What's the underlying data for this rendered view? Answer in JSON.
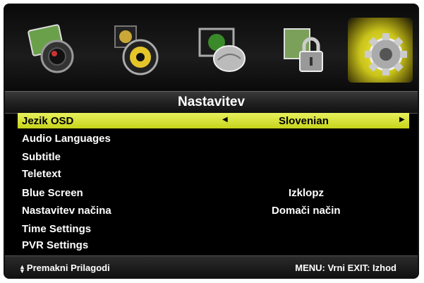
{
  "menu": {
    "title": "Nastavitev",
    "categories": [
      {
        "name": "picture-icon"
      },
      {
        "name": "sound-icon"
      },
      {
        "name": "channel-icon"
      },
      {
        "name": "lock-icon"
      },
      {
        "name": "setup-gear-icon",
        "active": true
      }
    ],
    "items": [
      {
        "label": "Jezik OSD",
        "value": "Slovenian",
        "selected": true
      },
      {
        "label": "Audio Languages",
        "value": ""
      },
      {
        "label": "Subtitle",
        "value": ""
      },
      {
        "label": "Teletext",
        "value": ""
      },
      {
        "label": "Blue Screen",
        "value": "Izklopz"
      },
      {
        "label": "Nastavitev načina",
        "value": "Domači način"
      },
      {
        "label": "Time Settings",
        "value": ""
      },
      {
        "label": "PVR Settings",
        "value": ""
      }
    ]
  },
  "footer": {
    "left": "Premakni Prilagodi",
    "right": "MENU: Vrni EXIT: Izhod"
  },
  "colors": {
    "selection": "#d8e43a",
    "active_tab_glow": "#f4ef3a"
  }
}
